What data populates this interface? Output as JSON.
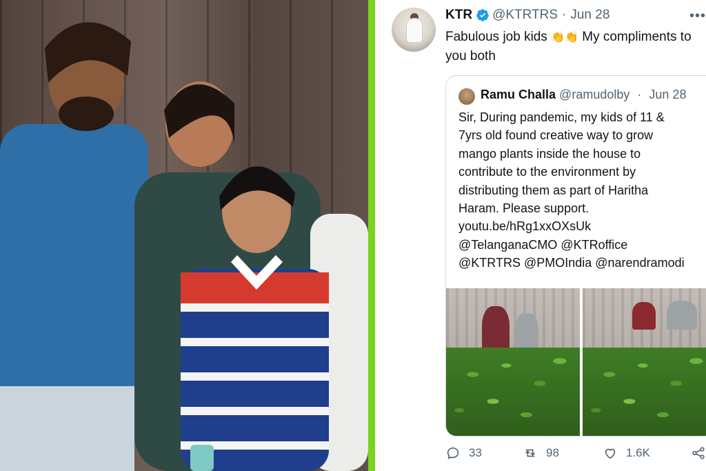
{
  "tweet": {
    "author_name": "KTR",
    "handle": "@KTRTRS",
    "separator": "·",
    "date": "Jun 28",
    "text": "Fabulous job kids",
    "emoji": "👏👏",
    "text_rest": "My compliments to you both",
    "more_icon": "more-horizontal-icon"
  },
  "quoted": {
    "author_name": "Ramu Challa",
    "handle": "@ramudolby",
    "separator": "·",
    "date": "Jun 28",
    "text_lines": [
      "Sir, During pandemic, my kids of 11 &",
      "7yrs old found creative way to grow",
      "mango plants inside the house to",
      "contribute to the environment by",
      "distributing them as part of Haritha",
      "Haram. Please support.",
      "youtu.be/hRg1xxOXsUk",
      "@TelanganaCMO @KTRoffice",
      "@KTRTRS @PMOIndia @narendramodi"
    ]
  },
  "actions": {
    "replies": "33",
    "retweets": "98",
    "likes": "1.6K"
  },
  "colors": {
    "divider": "#7ad321",
    "verified": "#1d9bf0",
    "secondary_text": "#536471",
    "border": "#cfd9de"
  }
}
